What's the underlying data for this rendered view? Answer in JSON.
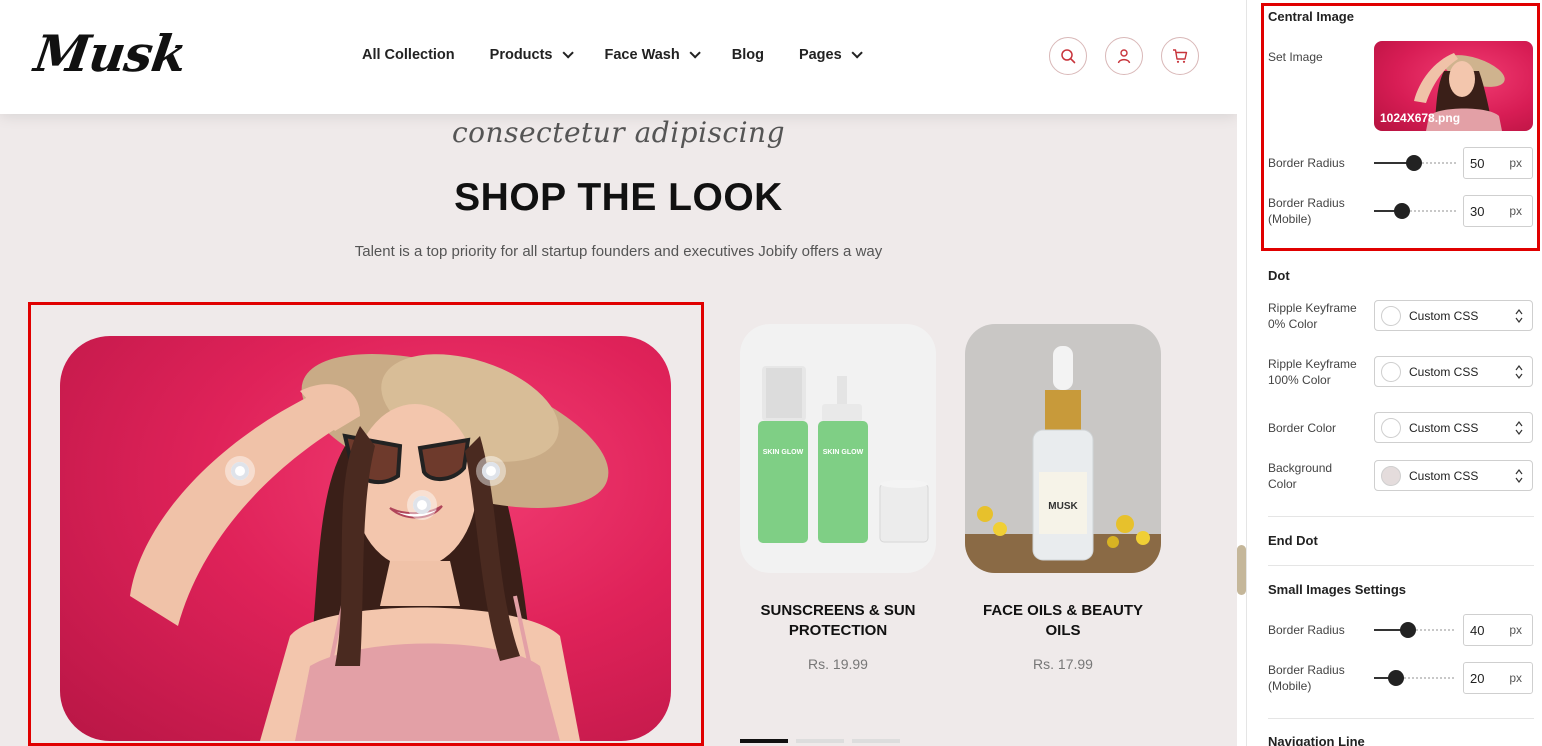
{
  "header": {
    "logo": "Musk",
    "nav": [
      {
        "label": "All Collection",
        "has_dropdown": false
      },
      {
        "label": "Products",
        "has_dropdown": true
      },
      {
        "label": "Face Wash",
        "has_dropdown": true
      },
      {
        "label": "Blog",
        "has_dropdown": false
      },
      {
        "label": "Pages",
        "has_dropdown": true
      }
    ],
    "icons": [
      "search-icon",
      "user-icon",
      "cart-icon"
    ],
    "accent_color": "#c8343b"
  },
  "section": {
    "script_subtitle": "consectetur adipiscing",
    "title": "SHOP THE LOOK",
    "description": "Talent is a top priority for all startup founders and executives Jobify offers a way"
  },
  "products": [
    {
      "name_line1": "SUNSCREENS & SUN",
      "name_line2": "PROTECTION",
      "price": "Rs. 19.99",
      "bottle_label": "SKIN GLOW"
    },
    {
      "name_line1": "FACE OILS & BEAUTY OILS",
      "name_line2": "",
      "price": "Rs. 17.99",
      "bottle_label": "MUSK"
    }
  ],
  "highlight_color": "#e00000",
  "panel": {
    "central_image": {
      "title": "Central Image",
      "set_image_label": "Set Image",
      "image_caption": "1024X678.png",
      "border_radius_label": "Border Radius",
      "border_radius_value": "50",
      "border_radius_mobile_label_1": "Border Radius",
      "border_radius_mobile_label_2": "(Mobile)",
      "border_radius_mobile_value": "30",
      "unit": "px"
    },
    "dot": {
      "title": "Dot",
      "rows": [
        {
          "label1": "Ripple Keyframe",
          "label2": "0% Color",
          "value": "Custom CSS",
          "swatch": "#ffffff"
        },
        {
          "label1": "Ripple Keyframe",
          "label2": "100% Color",
          "value": "Custom CSS",
          "swatch": "#ffffff"
        },
        {
          "label1": "Border Color",
          "label2": "",
          "value": "Custom CSS",
          "swatch": "#ffffff"
        },
        {
          "label1": "Background",
          "label2": "Color",
          "value": "Custom CSS",
          "swatch": "#e4dcdc"
        }
      ]
    },
    "end_dot": {
      "title": "End Dot"
    },
    "small_images": {
      "title": "Small Images Settings",
      "border_radius_label": "Border Radius",
      "border_radius_value": "40",
      "border_radius_mobile_label_1": "Border Radius",
      "border_radius_mobile_label_2": "(Mobile)",
      "border_radius_mobile_value": "20",
      "unit": "px"
    },
    "navigation_line": {
      "title": "Navigation Line"
    }
  }
}
